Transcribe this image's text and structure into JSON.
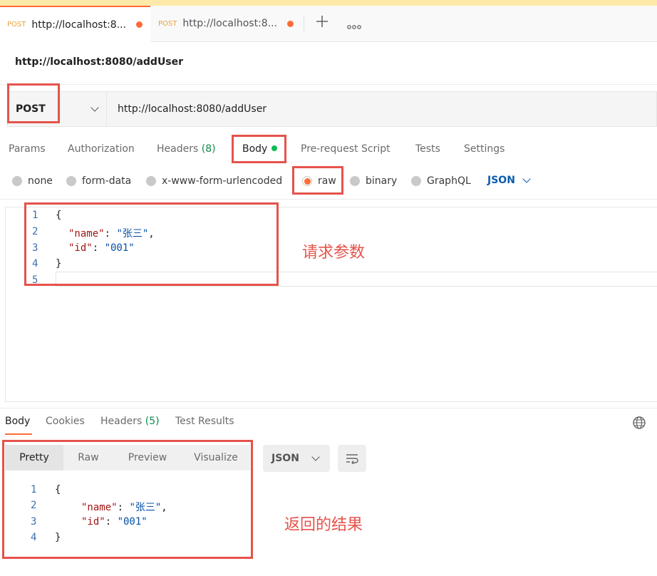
{
  "tabs": [
    {
      "method": "POST",
      "title": "http://localhost:8..."
    },
    {
      "method": "POST",
      "title": "http://localhost:8..."
    }
  ],
  "icons": {
    "new_tab": "plus-icon",
    "more": "more-icon",
    "method_dropdown": "chevron-down-icon",
    "globe": "globe-icon",
    "wrap": "wrap-icon"
  },
  "request": {
    "title": "http://localhost:8080/addUser",
    "method": "POST",
    "url": "http://localhost:8080/addUser"
  },
  "request_tabs": {
    "params": "Params",
    "authorization": "Authorization",
    "headers": "Headers",
    "headers_count": "(8)",
    "body": "Body",
    "prerequest": "Pre-request Script",
    "tests": "Tests",
    "settings": "Settings"
  },
  "body_types": {
    "none": "none",
    "form_data": "form-data",
    "urlencoded": "x-www-form-urlencoded",
    "raw": "raw",
    "binary": "binary",
    "graphql": "GraphQL",
    "format": "JSON"
  },
  "request_body": {
    "line_numbers": [
      "1",
      "2",
      "3",
      "4",
      "5"
    ],
    "open_brace": "{",
    "name_key": "\"name\"",
    "name_value": "\"张三\"",
    "id_key": "\"id\"",
    "id_value": "\"001\"",
    "close_brace": "}"
  },
  "annotations": {
    "request_params": "请求参数",
    "response_result": "返回的结果"
  },
  "response_tabs": {
    "body": "Body",
    "cookies": "Cookies",
    "headers": "Headers",
    "headers_count": "(5)",
    "test_results": "Test Results"
  },
  "response_view": {
    "pretty": "Pretty",
    "raw": "Raw",
    "preview": "Preview",
    "visualize": "Visualize",
    "format": "JSON"
  },
  "response_body": {
    "line_numbers": [
      "1",
      "2",
      "3",
      "4"
    ],
    "open_brace": "{",
    "name_key": "\"name\"",
    "name_value": "\"张三\"",
    "id_key": "\"id\"",
    "id_value": "\"001\"",
    "close_brace": "}"
  },
  "colors": {
    "accent": "#ff6c37",
    "annotation_red": "#e5534b",
    "json_blue": "#0b5cad",
    "status_green": "#0cbb52"
  }
}
